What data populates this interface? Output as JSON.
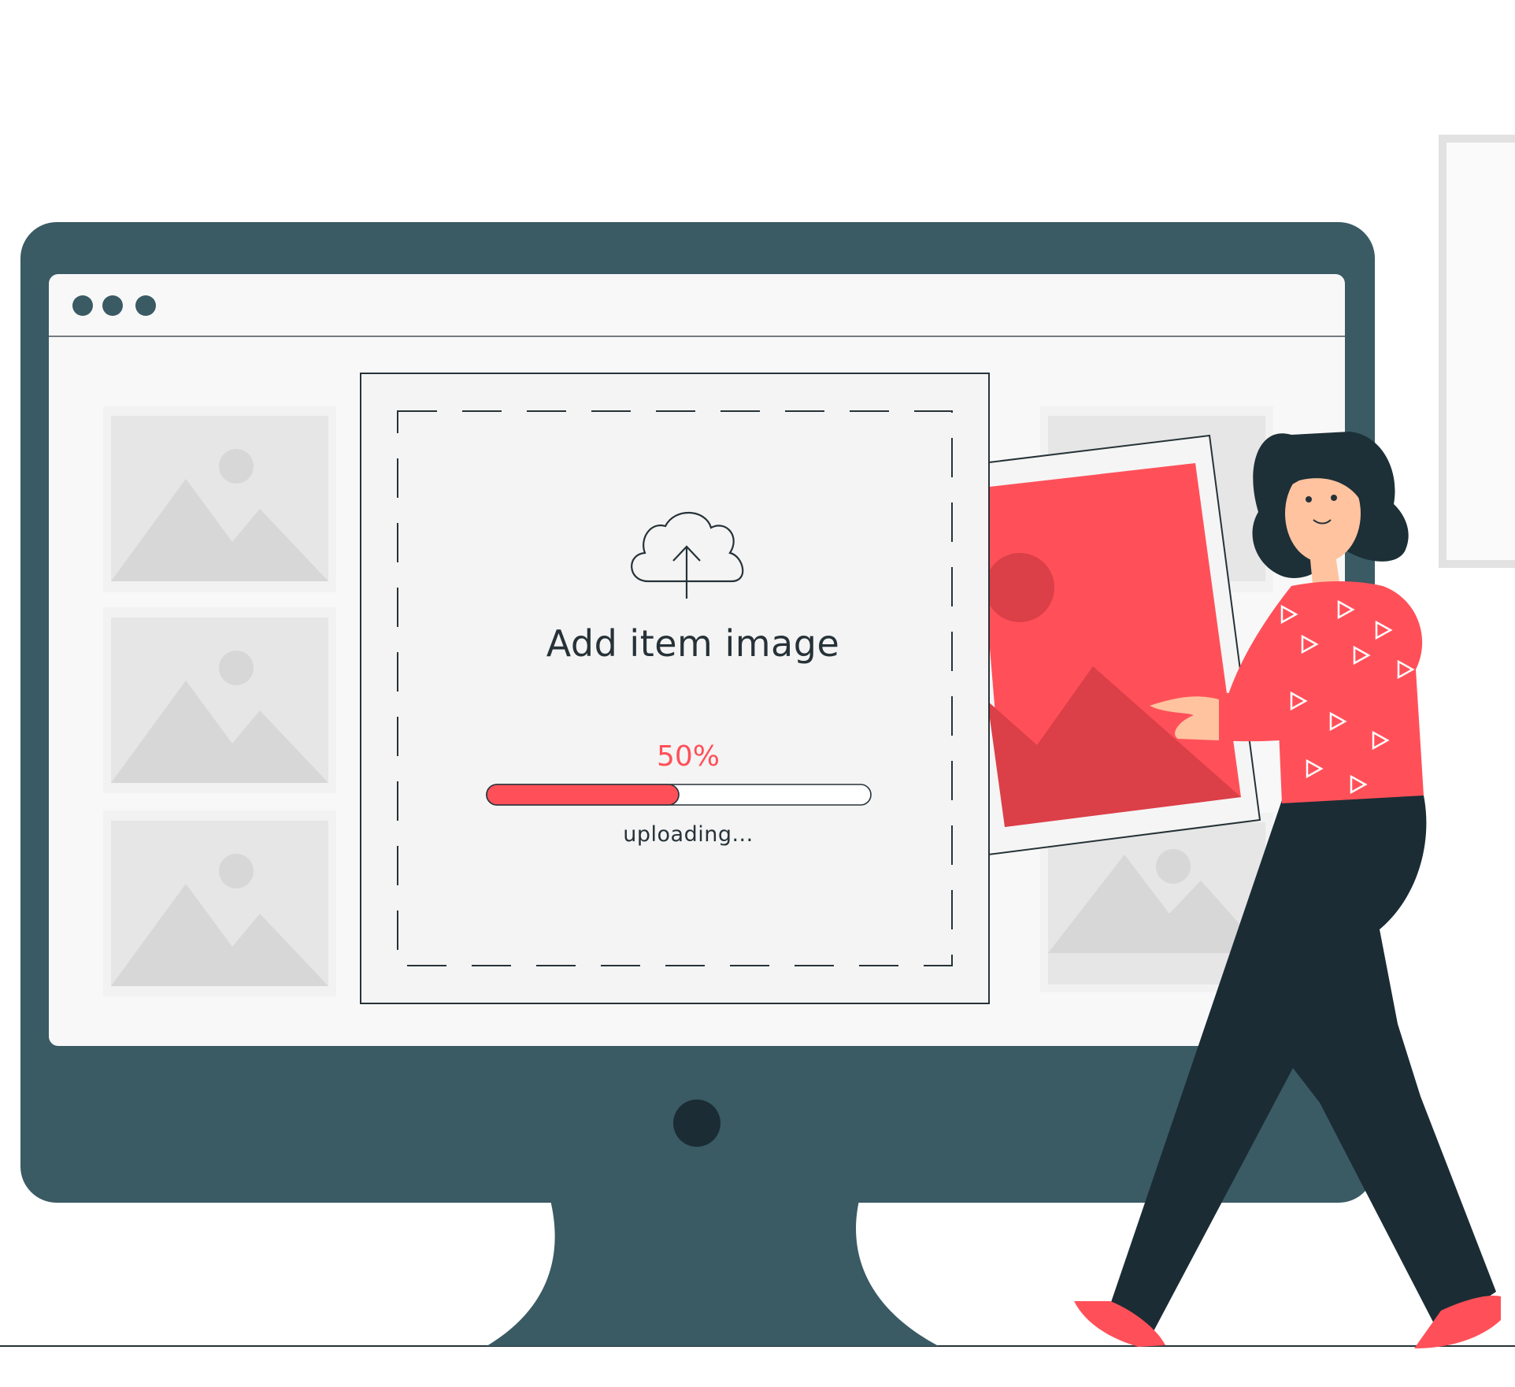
{
  "upload_dialog": {
    "title": "Add item image",
    "progress_label": "50%",
    "progress_fraction": 0.5,
    "status": "uploading..."
  },
  "colors": {
    "monitor": "#3a5a64",
    "accent": "#ff5059",
    "accent_dark": "#db3f48",
    "placeholder": "#e6e6e6",
    "pants": "#1b2c34",
    "skin": "#ffc3a0",
    "hair": "#1d2f37"
  },
  "icons": {
    "upload": "cloud-upload-icon",
    "window_controls": "window-dots-icon",
    "placeholder": "image-placeholder-icon"
  }
}
